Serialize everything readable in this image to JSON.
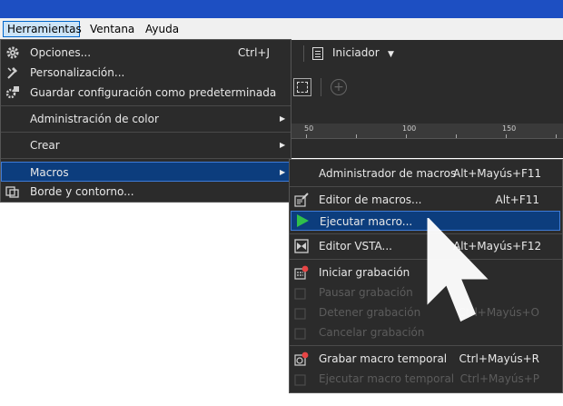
{
  "menubar": {
    "items": [
      {
        "label": "Herramientas"
      },
      {
        "label": "Ventana"
      },
      {
        "label": "Ayuda"
      }
    ]
  },
  "toolbar": {
    "launcher_label": "Iniciador"
  },
  "ruler": {
    "labels": [
      "50",
      "100",
      "150"
    ]
  },
  "tools_menu": {
    "items": [
      {
        "label": "Opciones...",
        "shortcut": "Ctrl+J"
      },
      {
        "label": "Personalización..."
      },
      {
        "label": "Guardar configuración como predeterminada"
      },
      {
        "label": "Administración de color"
      },
      {
        "label": "Crear"
      },
      {
        "label": "Macros"
      },
      {
        "label": "Borde y contorno..."
      }
    ]
  },
  "macros_menu": {
    "items": [
      {
        "label": "Administrador de macros",
        "shortcut": "Alt+Mayús+F11"
      },
      {
        "label": "Editor de macros...",
        "shortcut": "Alt+F11"
      },
      {
        "label": "Ejecutar macro..."
      },
      {
        "label": "Editor VSTA...",
        "shortcut": "Alt+Mayús+F12"
      },
      {
        "label": "Iniciar grabación"
      },
      {
        "label": "Pausar grabación"
      },
      {
        "label": "Detener grabación",
        "shortcut": "Ctrl+Mayús+O"
      },
      {
        "label": "Cancelar grabación"
      },
      {
        "label": "Grabar macro temporal",
        "shortcut": "Ctrl+Mayús+R"
      },
      {
        "label": "Ejecutar macro temporal",
        "shortcut": "Ctrl+Mayús+P"
      }
    ]
  },
  "colors": {
    "menu_bg": "#2b2b2b",
    "highlight": "#0c3d7d",
    "disabled_text": "#5c5c5c",
    "top_strip": "#1d4fc2"
  }
}
